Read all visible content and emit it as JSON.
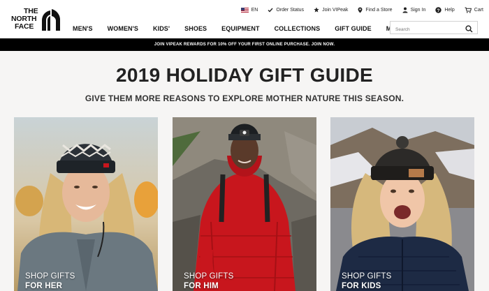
{
  "brand": {
    "logo_line1": "THE",
    "logo_line2": "NORTH",
    "logo_line3": "FACE",
    "logo_mark": "®"
  },
  "utility": {
    "language": "EN",
    "order_status": "Order Status",
    "loyalty": "Join VIPeak",
    "find_store": "Find a Store",
    "sign_in": "Sign In",
    "help": "Help",
    "cart": "Cart"
  },
  "nav": [
    "MEN'S",
    "WOMEN'S",
    "KIDS'",
    "SHOES",
    "EQUIPMENT",
    "COLLECTIONS",
    "GIFT GUIDE",
    "MORE"
  ],
  "search": {
    "placeholder": "Search"
  },
  "promo": "JOIN VIPEAK REWARDS FOR 10% OFF YOUR FIRST ONLINE PURCHASE. JOIN NOW.",
  "hero": {
    "title": "2019 HOLIDAY GIFT GUIDE",
    "subtitle": "GIVE THEM MORE REASONS TO EXPLORE MOTHER NATURE THIS SEASON."
  },
  "tiles": [
    {
      "line1": "SHOP GIFTS",
      "line2": "FOR HER"
    },
    {
      "line1": "SHOP GIFTS",
      "line2": "FOR HIM"
    },
    {
      "line1": "SHOP GIFTS",
      "line2": "FOR KIDS"
    }
  ],
  "colors": {
    "promo_bg": "#000000",
    "jacket_red": "#c8161d",
    "page_bg": "#f6f5f4"
  }
}
